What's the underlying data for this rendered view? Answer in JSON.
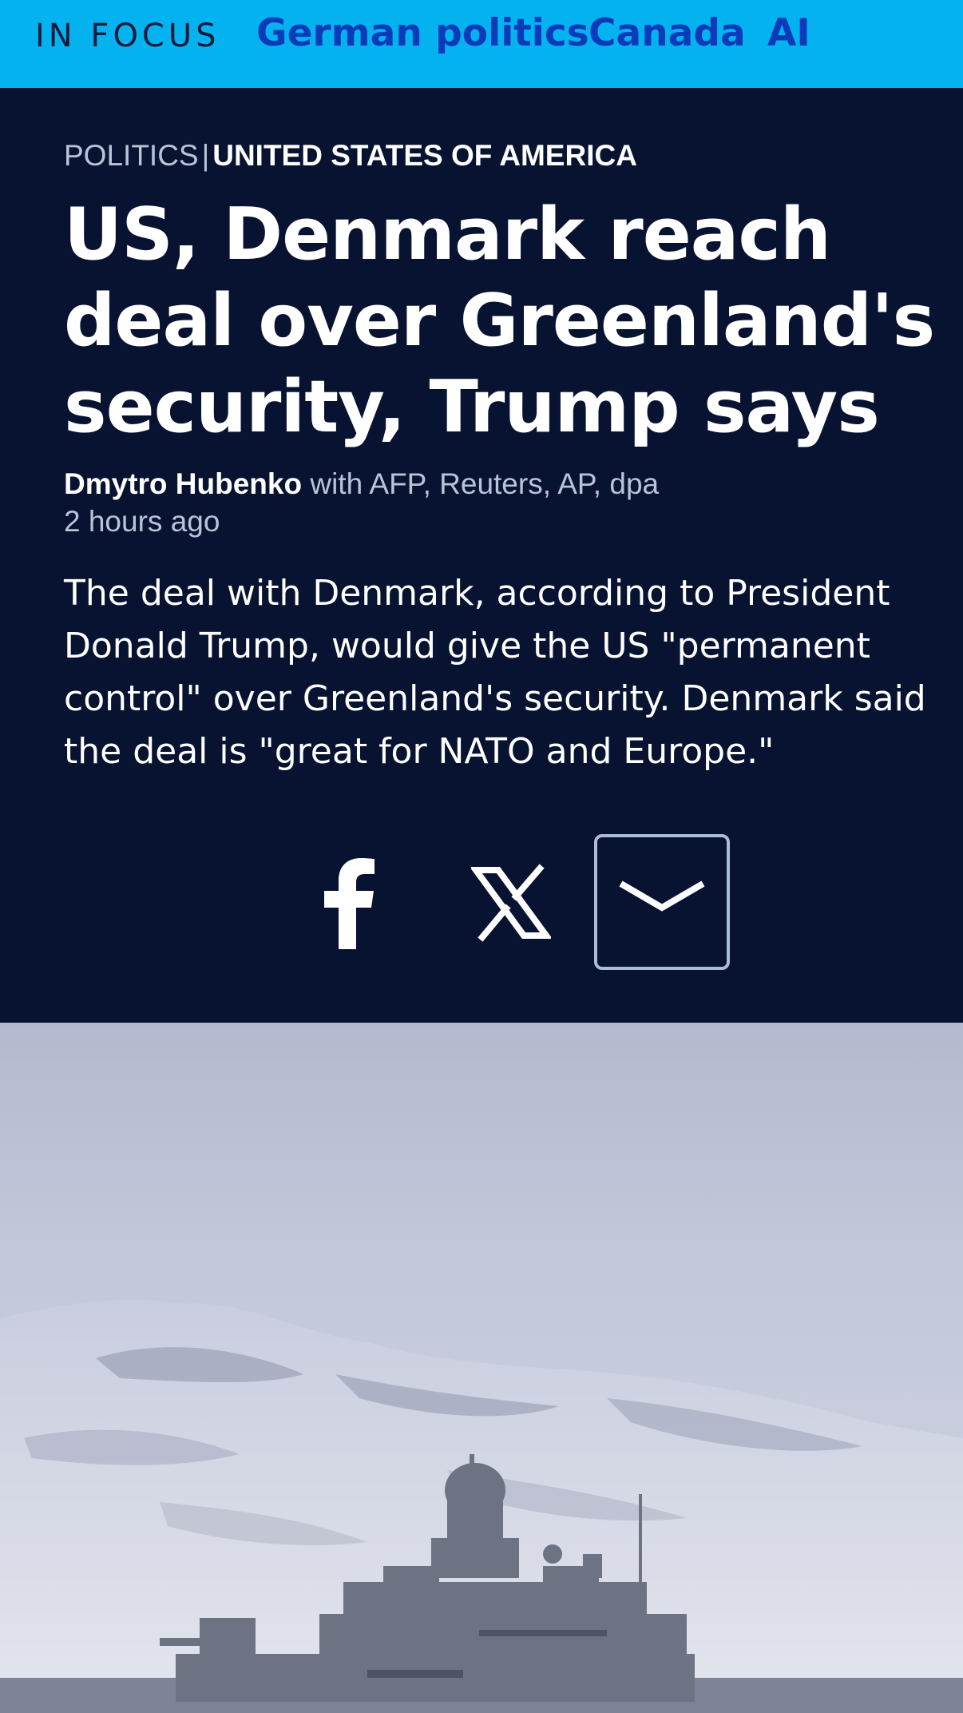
{
  "focus": {
    "label": "IN FOCUS",
    "links": [
      "German politics",
      "Canada",
      "AI"
    ]
  },
  "article": {
    "category": "POLITICS",
    "separator": "|",
    "country": "UNITED STATES OF AMERICA",
    "headline": "US, Denmark reach deal over Greenland's security, Trump says",
    "author": "Dmytro Hubenko",
    "sources": "with AFP, Reuters, AP, dpa",
    "timestamp": "2 hours ago",
    "teaser": "The deal with Denmark, according to President Donald Trump, would give the US \"permanent control\" over Greenland's security. Denmark said the deal is \"great for NATO and Europe.\""
  },
  "share": {
    "icons": [
      "facebook-icon",
      "x-icon",
      "chevron-down-icon"
    ]
  },
  "photo": {
    "subject": "naval-ship-image"
  },
  "colors": {
    "focus_bar": "#05B2F0",
    "focus_link": "#0B3BB8",
    "header_bg": "#071331",
    "muted_text": "#B8C4D8"
  }
}
